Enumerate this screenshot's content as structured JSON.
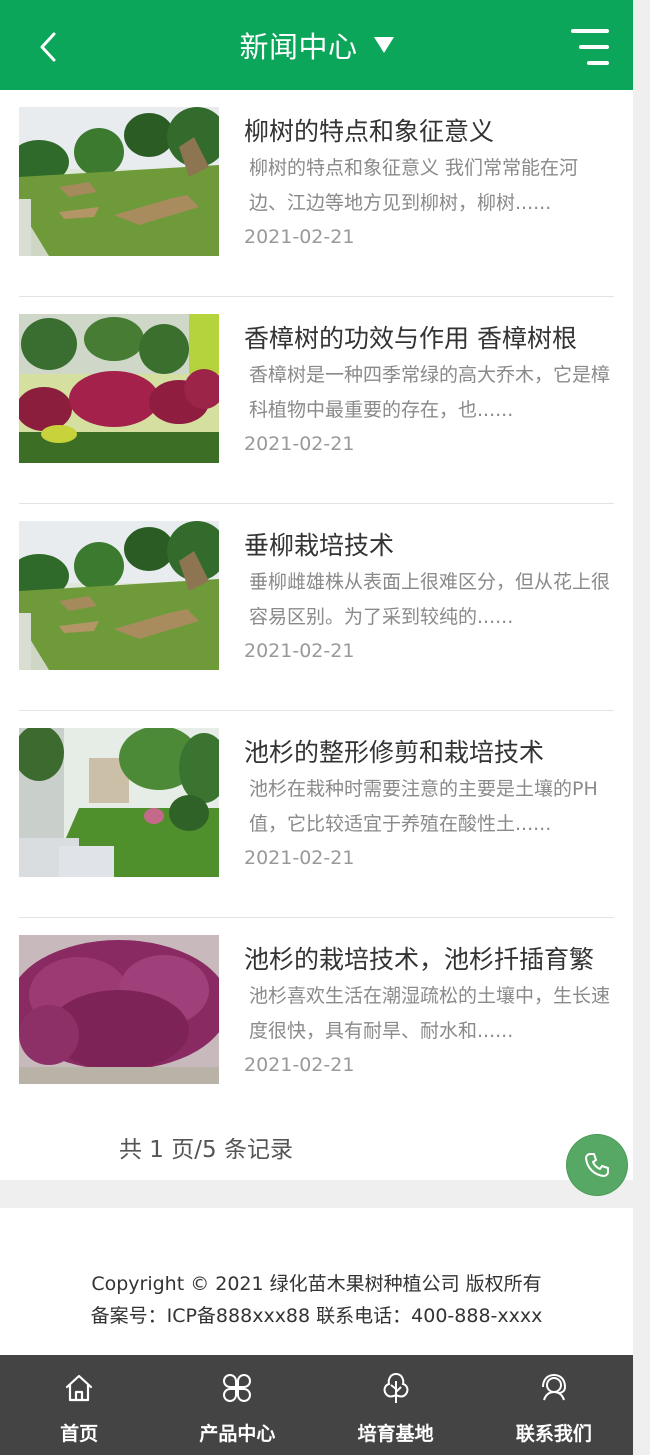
{
  "header": {
    "title": "新闻中心",
    "back_icon": "chevron-left-icon",
    "dropdown_icon": "caret-down-icon",
    "menu_icon": "menu-icon",
    "background_color": "#0ba65a"
  },
  "news": [
    {
      "title": "柳树的特点和象征意义",
      "summary": "柳树的特点和象征意义 我们常常能在河边、江边等地方见到柳树，柳树......",
      "date": "2021-02-21",
      "image": "garden-lawn-sculptures-photo"
    },
    {
      "title": "香樟树的功效与作用 香樟树根",
      "summary": "香樟树是一种四季常绿的高大乔木，它是樟科植物中最重要的存在，也......",
      "date": "2021-02-21",
      "image": "red-maple-garden-photo"
    },
    {
      "title": "垂柳栽培技术",
      "summary": "垂柳雌雄株从表面上很难区分，但从花上很容易区别。为了采到较纯的......",
      "date": "2021-02-21",
      "image": "garden-lawn-sculptures-photo"
    },
    {
      "title": "池杉的整形修剪和栽培技术",
      "summary": "池杉在栽种时需要注意的主要是土壤的PH值，它比较适宜于养殖在酸性土......",
      "date": "2021-02-21",
      "image": "villa-garden-lawn-photo"
    },
    {
      "title": "池杉的栽培技术，池杉扦插育繁",
      "summary": "池杉喜欢生活在潮湿疏松的土壤中，生长速度很快，具有耐旱、耐水和......",
      "date": "2021-02-21",
      "image": "purple-shrub-photo"
    }
  ],
  "pagination": {
    "text": "共 1 页/5 条记录"
  },
  "call_button": {
    "icon": "phone-icon",
    "color": "#58a865"
  },
  "footer": {
    "copyright": "Copyright © 2021 绿化苗木果树种植公司 版权所有",
    "record": "备案号：ICP备888xxx88   联系电话：400-888-xxxx"
  },
  "bottom_nav": [
    {
      "label": "首页",
      "icon": "home-icon"
    },
    {
      "label": "产品中心",
      "icon": "grid-petals-icon"
    },
    {
      "label": "培育基地",
      "icon": "tree-icon"
    },
    {
      "label": "联系我们",
      "icon": "support-agent-icon"
    }
  ]
}
